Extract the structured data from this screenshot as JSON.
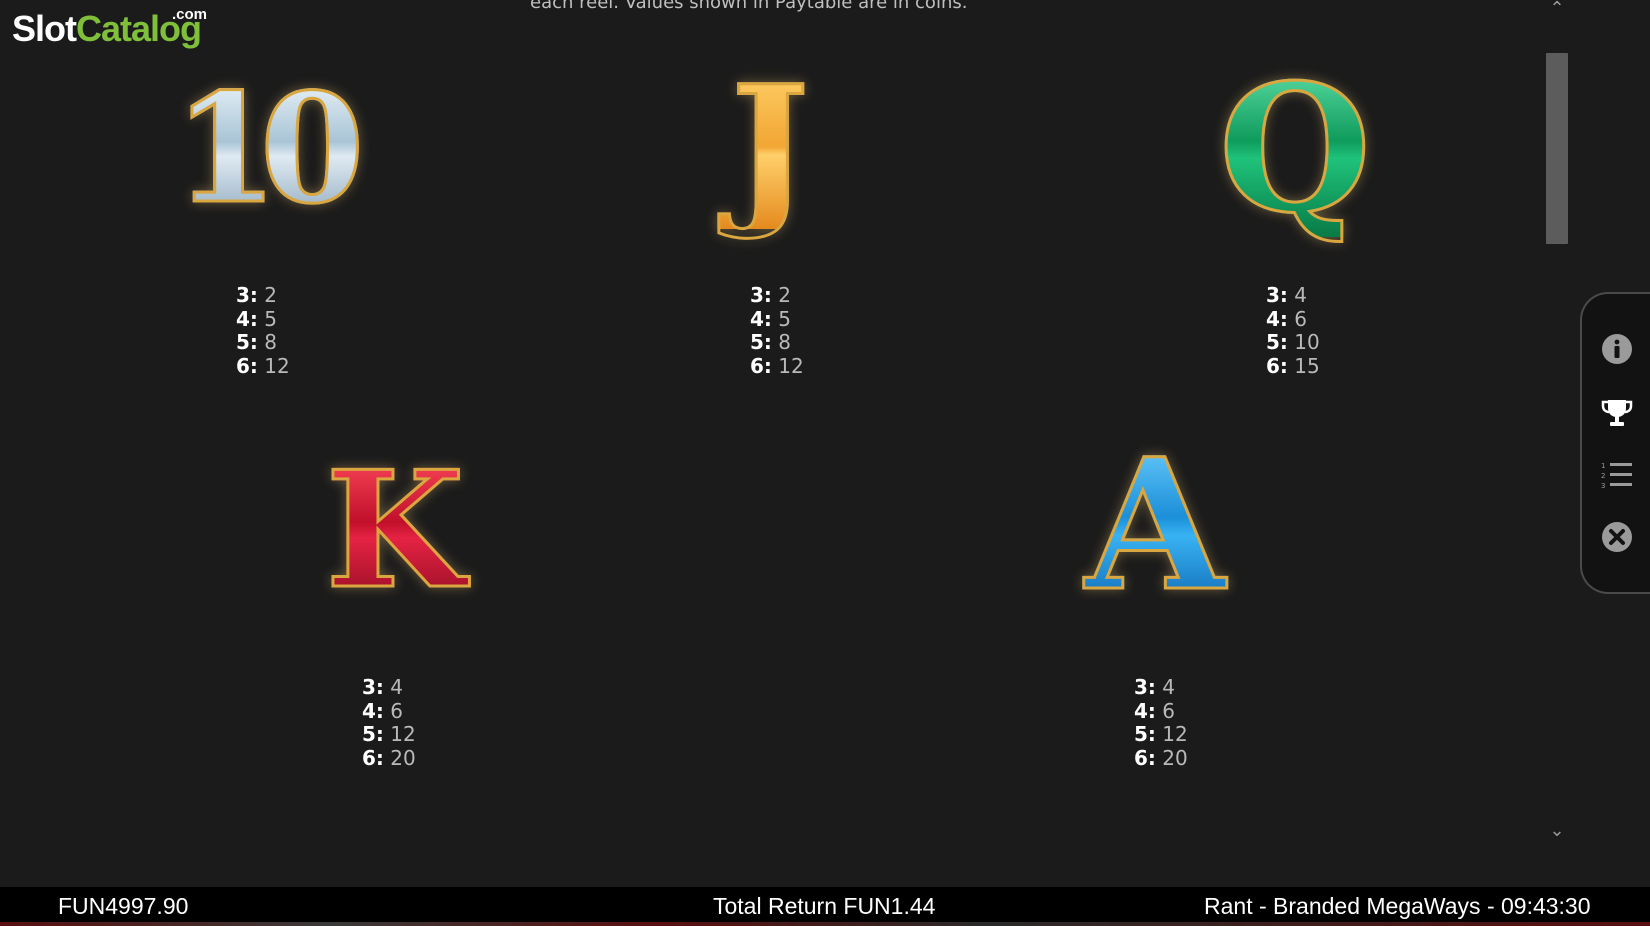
{
  "logo": {
    "slot": "Slot",
    "catalog": "Catalog",
    "com": ".com"
  },
  "intro_text": "each reel. Values shown in Paytable are in coins.",
  "symbols": [
    {
      "glyph": "10",
      "pays": [
        {
          "count": "3:",
          "value": "2"
        },
        {
          "count": "4:",
          "value": "5"
        },
        {
          "count": "5:",
          "value": "8"
        },
        {
          "count": "6:",
          "value": "12"
        }
      ]
    },
    {
      "glyph": "J",
      "pays": [
        {
          "count": "3:",
          "value": "2"
        },
        {
          "count": "4:",
          "value": "5"
        },
        {
          "count": "5:",
          "value": "8"
        },
        {
          "count": "6:",
          "value": "12"
        }
      ]
    },
    {
      "glyph": "Q",
      "pays": [
        {
          "count": "3:",
          "value": "4"
        },
        {
          "count": "4:",
          "value": "6"
        },
        {
          "count": "5:",
          "value": "10"
        },
        {
          "count": "6:",
          "value": "15"
        }
      ]
    },
    {
      "glyph": "K",
      "pays": [
        {
          "count": "3:",
          "value": "4"
        },
        {
          "count": "4:",
          "value": "6"
        },
        {
          "count": "5:",
          "value": "12"
        },
        {
          "count": "6:",
          "value": "20"
        }
      ]
    },
    {
      "glyph": "A",
      "pays": [
        {
          "count": "3:",
          "value": "4"
        },
        {
          "count": "4:",
          "value": "6"
        },
        {
          "count": "5:",
          "value": "12"
        },
        {
          "count": "6:",
          "value": "20"
        }
      ]
    }
  ],
  "scroll": {
    "up_glyph": "⌃",
    "down_glyph": "⌄"
  },
  "side_menu": [
    "info-icon",
    "trophy-icon",
    "numbered-list-icon",
    "close-icon"
  ],
  "status_bar": {
    "balance": "FUN4997.90",
    "total_return": "Total Return FUN1.44",
    "game_info": "Rant - Branded MegaWays - 09:43:30"
  },
  "colors": {
    "background": "#1b1b1b",
    "logo_green": "#7fbf3a",
    "gold_outline": "#d9a640"
  }
}
